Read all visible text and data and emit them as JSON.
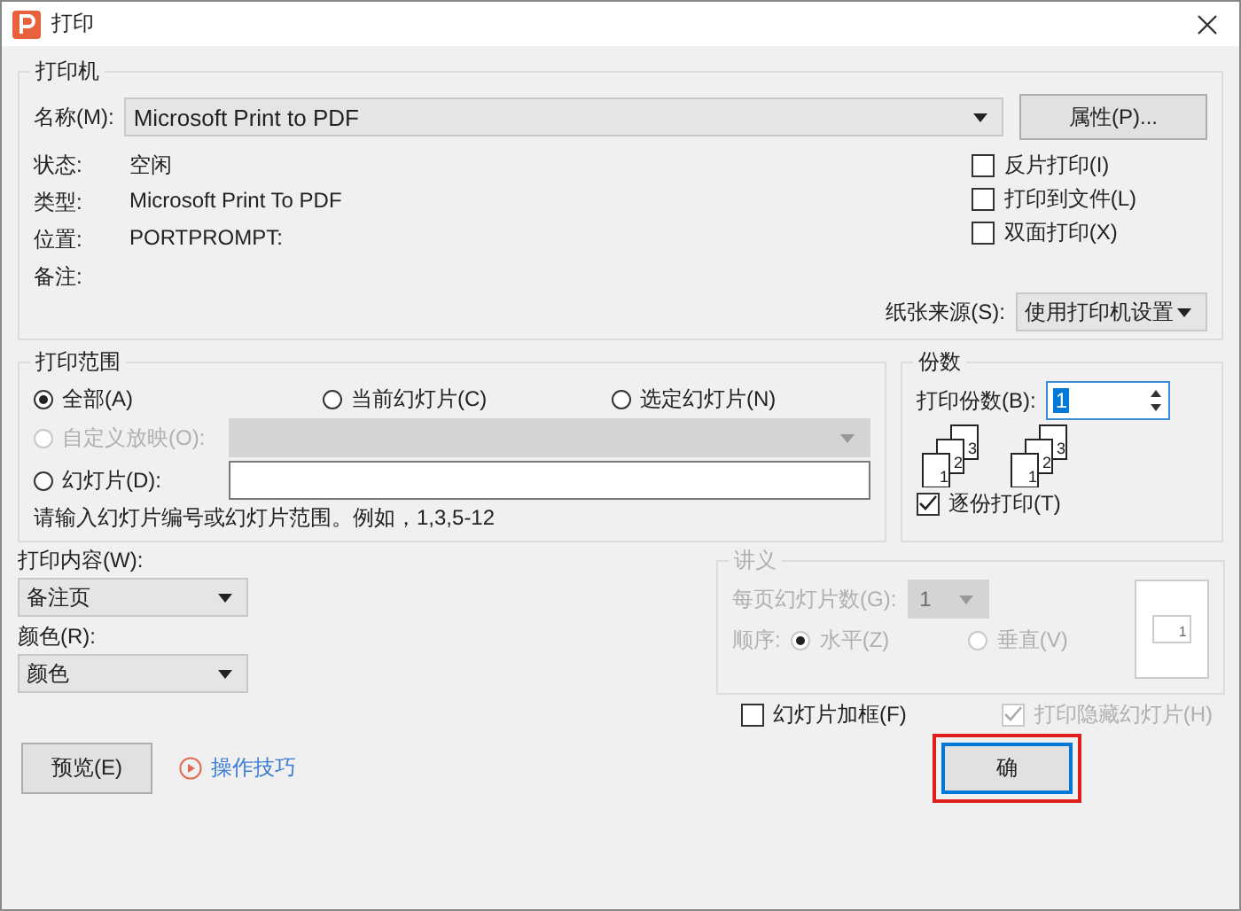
{
  "window": {
    "title": "打印"
  },
  "printer": {
    "legend": "打印机",
    "name_label": "名称(M):",
    "name_value": "Microsoft Print to PDF",
    "properties_button": "属性(P)...",
    "info": [
      {
        "label": "状态:",
        "value": "空闲"
      },
      {
        "label": "类型:",
        "value": "Microsoft Print To PDF"
      },
      {
        "label": "位置:",
        "value": "PORTPROMPT:"
      },
      {
        "label": "备注:"
      }
    ],
    "options": [
      {
        "label": "反片打印(I)",
        "checked": false
      },
      {
        "label": "打印到文件(L)",
        "checked": false
      },
      {
        "label": "双面打印(X)",
        "checked": false
      }
    ],
    "paper_source_label": "纸张来源(S):",
    "paper_source_value": "使用打印机设置"
  },
  "range": {
    "legend": "打印范围",
    "options": [
      {
        "label": "全部(A)",
        "selected": true
      },
      {
        "label": "当前幻灯片(C)",
        "selected": false
      },
      {
        "label": "选定幻灯片(N)",
        "selected": false
      }
    ],
    "custom_show": {
      "label": "自定义放映(O):",
      "selected": false,
      "disabled": true
    },
    "slides": {
      "label": "幻灯片(D):",
      "selected": false
    },
    "hint": "请输入幻灯片编号或幻灯片范围。例如，1,3,5-12"
  },
  "copies": {
    "legend": "份数",
    "label": "打印份数(B):",
    "value": "1",
    "stacks": [
      {
        "pages": [
          "1",
          "2",
          "3"
        ]
      },
      {
        "pages": [
          "1",
          "2",
          "3"
        ]
      }
    ],
    "collate": {
      "label": "逐份打印(T)",
      "checked": true
    }
  },
  "print_what": {
    "label": "打印内容(W):",
    "value": "备注页"
  },
  "color": {
    "label": "颜色(R):",
    "value": "颜色"
  },
  "handouts": {
    "legend": "讲义",
    "disabled": true,
    "per_page_label": "每页幻灯片数(G):",
    "per_page_value": "1",
    "order_label": "顺序:",
    "order": [
      {
        "label": "水平(Z)",
        "selected": true
      },
      {
        "label": "垂直(V)",
        "selected": false
      }
    ],
    "preview_number": "1"
  },
  "frame_slides": {
    "label": "幻灯片加框(F)",
    "checked": false
  },
  "print_hidden": {
    "label": "打印隐藏幻灯片(H)",
    "checked": true,
    "disabled": true
  },
  "footer": {
    "preview_button": "预览(E)",
    "tips_link": "操作技巧",
    "ok_button": "确",
    "ok_highlighted": true
  }
}
